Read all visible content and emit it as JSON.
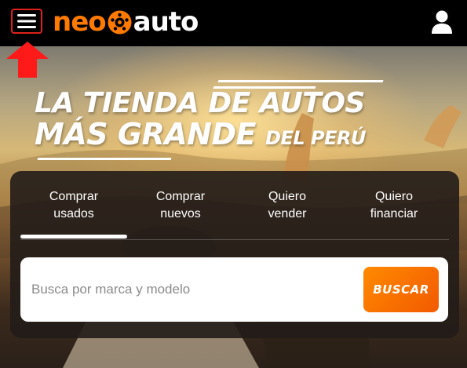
{
  "header": {
    "menu_icon": "hamburger-menu-icon",
    "logo": {
      "text_neo": "neo",
      "text_auto": "auto",
      "icon": "wheel-icon"
    },
    "user_icon": "user-account-icon"
  },
  "annotation": {
    "icon": "red-up-arrow-icon",
    "color": "#ff1a1a"
  },
  "hero": {
    "title_line1": "LA TIENDA DE AUTOS",
    "title_line2_bold": "MÁS GRANDE",
    "title_line2_small": "DEL PERÚ"
  },
  "search_panel": {
    "tabs": [
      {
        "line1": "Comprar",
        "line2": "usados",
        "active": true
      },
      {
        "line1": "Comprar",
        "line2": "nuevos",
        "active": false
      },
      {
        "line1": "Quiero",
        "line2": "vender",
        "active": false
      },
      {
        "line1": "Quiero",
        "line2": "financiar",
        "active": false
      }
    ],
    "search_placeholder": "Busca por marca y modelo",
    "search_value": "",
    "search_button_label": "BUSCAR"
  },
  "colors": {
    "brand_orange": "#ff7a00",
    "button_gradient_start": "#ff8a00",
    "button_gradient_end": "#f25a00",
    "highlight_red": "#e0211b"
  }
}
